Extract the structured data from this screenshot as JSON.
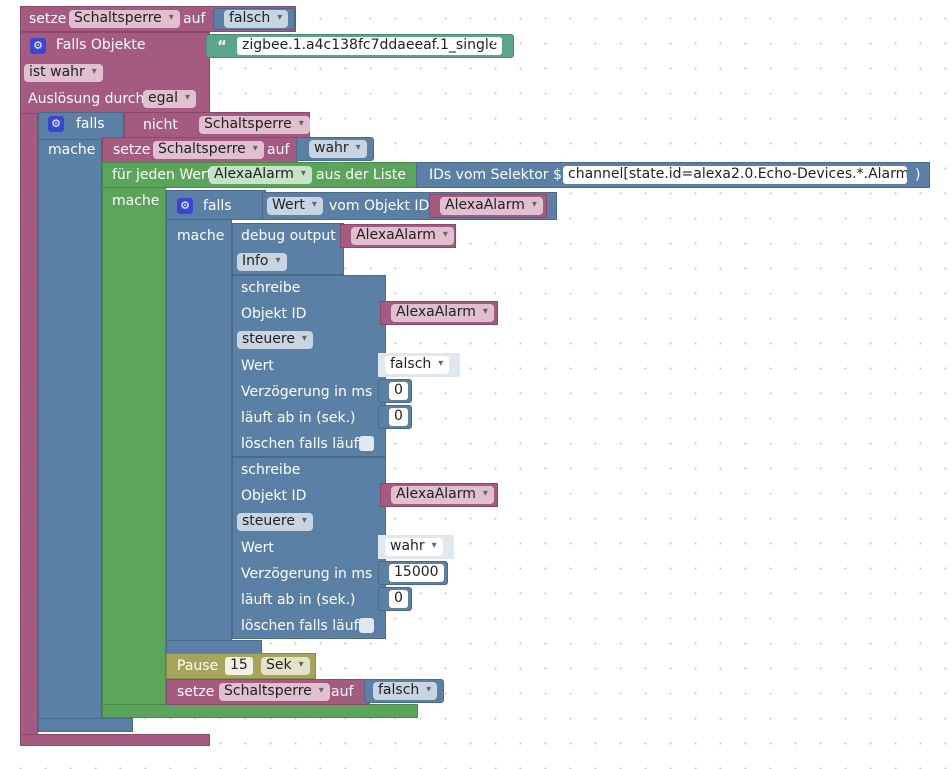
{
  "colors": {
    "pink": "#a55b80",
    "blue": "#5b80a5",
    "green": "#5ba55b",
    "olive": "#a5a55b",
    "teal": "#5ba58c"
  },
  "top_set": {
    "label_set": "setze",
    "var": "Schaltsperre",
    "label_on": "auf",
    "value": "falsch"
  },
  "trigger": {
    "gear_icon": "gear-icon",
    "title": "Falls Objekte",
    "object_id": "zigbee.1.a4c138fc7ddaeeaf.1_single",
    "condition": "ist wahr",
    "trigger_label": "Auslösung durch",
    "trigger_value": "egal"
  },
  "if1": {
    "label_if": "falls",
    "label_not": "nicht",
    "var": "Schaltsperre",
    "label_do": "mache"
  },
  "set2": {
    "label_set": "setze",
    "var": "Schaltsperre",
    "label_on": "auf",
    "value": "wahr"
  },
  "foreach": {
    "label": "für jeden Wert",
    "var": "AlexaAlarm",
    "label_from": "aus der Liste",
    "label_selector": "IDs vom Selektor $(",
    "selector": "channel[state.id=alexa2.0.Echo-Devices.*.Alarm.*...",
    "close": ")",
    "label_do": "mache"
  },
  "if2": {
    "label_if": "falls",
    "value": "Wert",
    "label_from": "vom Objekt ID",
    "var": "AlexaAlarm",
    "label_do": "mache"
  },
  "debug": {
    "label": "debug output",
    "var": "AlexaAlarm",
    "level": "Info"
  },
  "write1": {
    "title": "schreibe",
    "label_object": "Objekt ID",
    "object_var": "AlexaAlarm",
    "mode": "steuere",
    "label_value": "Wert",
    "value": "falsch",
    "label_delay": "Verzögerung in ms",
    "delay": "0",
    "label_expire": "läuft ab in (sek.)",
    "expire": "0",
    "label_clear": "löschen falls läuft"
  },
  "write2": {
    "title": "schreibe",
    "label_object": "Objekt ID",
    "object_var": "AlexaAlarm",
    "mode": "steuere",
    "label_value": "Wert",
    "value": "wahr",
    "label_delay": "Verzögerung in ms",
    "delay": "15000",
    "label_expire": "läuft ab in (sek.)",
    "expire": "0",
    "label_clear": "löschen falls läuft"
  },
  "pause": {
    "label": "Pause",
    "amount": "15",
    "unit": "Sek"
  },
  "set3": {
    "label_set": "setze",
    "var": "Schaltsperre",
    "label_on": "auf",
    "value": "falsch"
  }
}
